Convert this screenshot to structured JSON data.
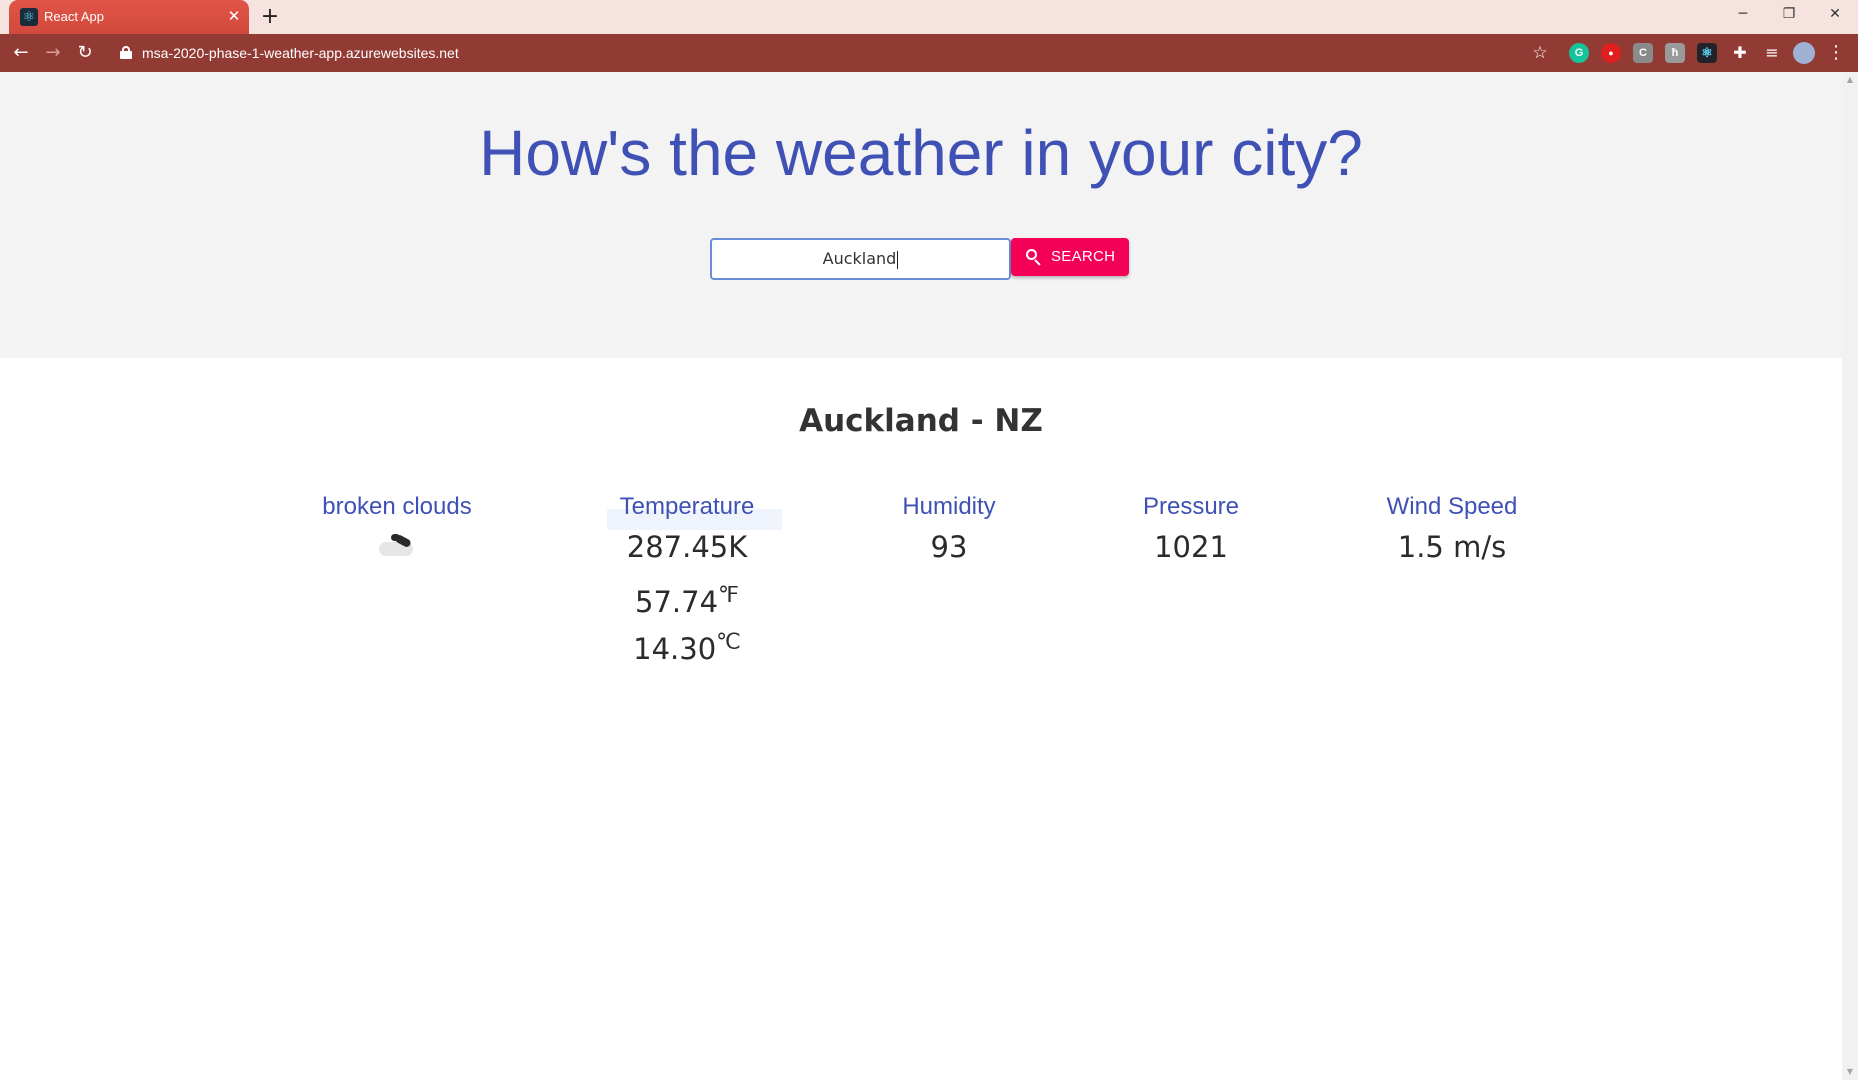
{
  "browser": {
    "tab_title": "React App",
    "tab_close": "✕",
    "new_tab": "+",
    "url": "msa-2020-phase-1-weather-app.azurewebsites.net",
    "nav": {
      "back": "←",
      "forward": "→",
      "reload": "↻"
    },
    "window": {
      "minimize": "─",
      "restore": "❐",
      "close": "✕"
    },
    "extensions": [
      {
        "name": "grammarly-extension-icon",
        "glyph": "G",
        "color": "#15c39a"
      },
      {
        "name": "red-extension-icon",
        "glyph": "●",
        "color": "#e02020"
      },
      {
        "name": "c-extension-icon",
        "glyph": "C",
        "color": "#8a8a8a"
      },
      {
        "name": "h-extension-icon",
        "glyph": "ħ",
        "color": "#9a9a9a"
      },
      {
        "name": "react-devtools-icon",
        "glyph": "⚛",
        "color": "#20232a"
      }
    ]
  },
  "hero": {
    "title": "How's the weather in your city?",
    "search_value": "Auckland",
    "search_button": "SEARCH"
  },
  "result": {
    "location": "Auckland - NZ",
    "metrics": [
      {
        "label": "broken clouds",
        "icon": "broken-clouds-icon"
      },
      {
        "label": "Temperature",
        "kelvin": "287.45K",
        "fahrenheit": "57.74",
        "fahrenheit_unit": "℉",
        "celsius": "14.30",
        "celsius_unit": "℃"
      },
      {
        "label": "Humidity",
        "value": "93"
      },
      {
        "label": "Pressure",
        "value": "1021"
      },
      {
        "label": "Wind Speed",
        "value": "1.5 m/s"
      }
    ]
  },
  "colors": {
    "primary": "#3f51b5",
    "accent": "#f50057",
    "toolbar": "#923b35",
    "tab": "#d24a3d"
  }
}
